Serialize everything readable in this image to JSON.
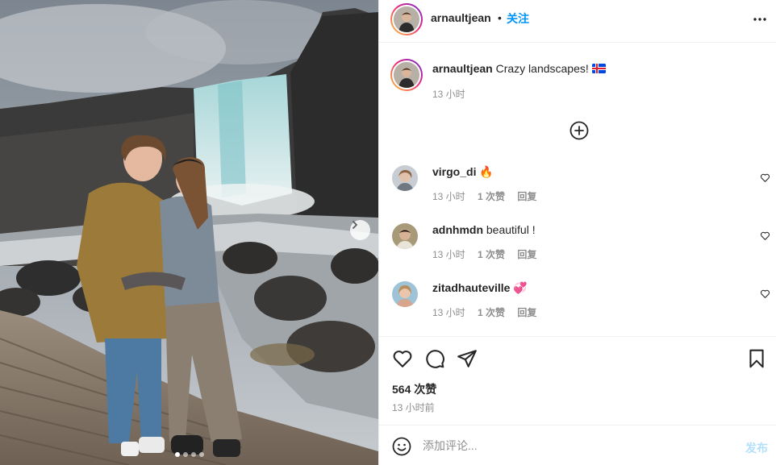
{
  "post": {
    "username": "arnaultjean",
    "separator": "•",
    "follow_label": "关注",
    "caption_text": "Crazy landscapes!",
    "caption_time": "13 小时",
    "likes": "564 次赞",
    "time_ago": "13 小时前",
    "photo_count": 4,
    "active_photo": 1
  },
  "comments": [
    {
      "username": "virgo_di",
      "text": "🔥",
      "time": "13 小时",
      "likes": "1 次赞",
      "reply": "回复"
    },
    {
      "username": "adnhmdn",
      "text": "beautiful !",
      "time": "13 小时",
      "likes": "1 次赞",
      "reply": "回复"
    },
    {
      "username": "zitadhauteville",
      "text": "💞",
      "time": "13 小时",
      "likes": "1 次赞",
      "reply": "回复"
    }
  ],
  "add_comment": {
    "placeholder": "添加评论...",
    "post_label": "发布"
  },
  "icons": {
    "more": "more-options-icon",
    "add": "plus-circle-icon",
    "like": "heart-icon",
    "comment": "comment-bubble-icon",
    "share": "paper-plane-icon",
    "save": "bookmark-icon",
    "emoji": "emoji-smile-icon",
    "next": "chevron-right-icon",
    "flag": "iceland-flag-icon"
  },
  "colors": {
    "accent_blue": "#0095f6",
    "post_disabled": "#b2dffc",
    "secondary_text": "#8e8e8e",
    "primary_text": "#262626"
  }
}
